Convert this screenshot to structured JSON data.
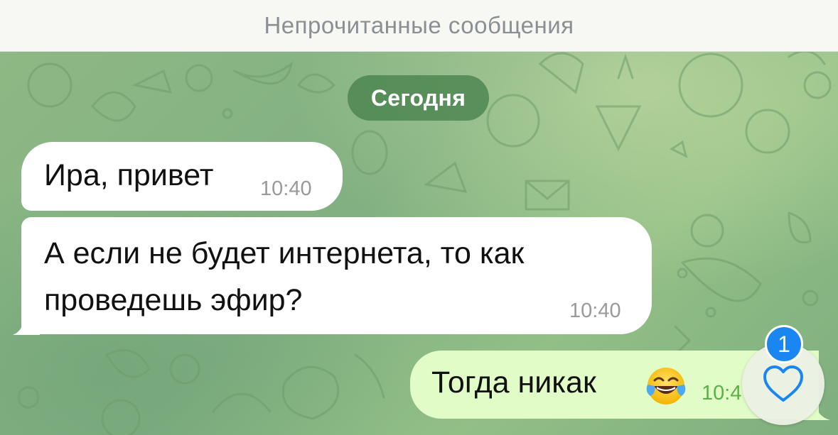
{
  "header": {
    "unread_label": "Непрочитанные сообщения"
  },
  "date_separator": "Сегодня",
  "messages": [
    {
      "direction": "incoming",
      "text": "Ира, привет",
      "time": "10:40"
    },
    {
      "direction": "incoming",
      "text": "А если не будет интернета, то как проведешь эфир?",
      "time": "10:40"
    },
    {
      "direction": "outgoing",
      "text": "Тогда никак",
      "emoji": "face-with-tears-of-joy",
      "time": "10:4"
    }
  ],
  "scroll_button": {
    "icon": "heart-icon",
    "unread_reactions_count": "1"
  },
  "colors": {
    "outgoing_bubble": "#e2fcc8",
    "incoming_bubble": "#ffffff",
    "date_pill": "#4a874d",
    "badge": "#1a86f2",
    "heart": "#1a86f2"
  }
}
